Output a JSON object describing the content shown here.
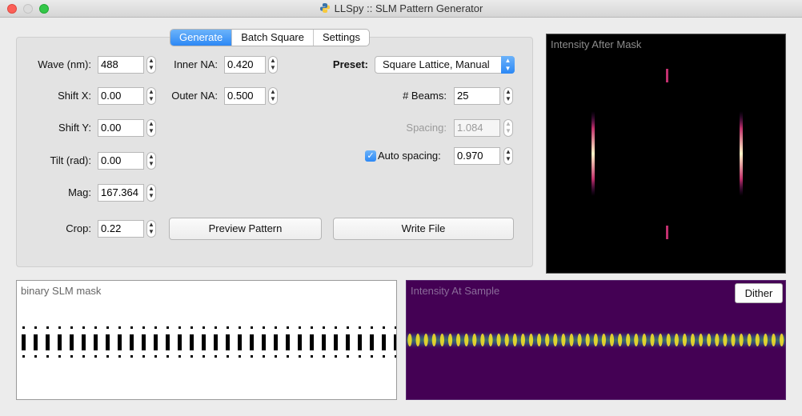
{
  "window": {
    "title": "LLSpy :: SLM Pattern Generator"
  },
  "tabs": [
    {
      "label": "Generate",
      "active": true
    },
    {
      "label": "Batch Square",
      "active": false
    },
    {
      "label": "Settings",
      "active": false
    }
  ],
  "left_fields": {
    "wave": {
      "label": "Wave (nm):",
      "value": "488"
    },
    "shift_x": {
      "label": "Shift X:",
      "value": "0.00"
    },
    "shift_y": {
      "label": "Shift Y:",
      "value": "0.00"
    },
    "tilt": {
      "label": "Tilt (rad):",
      "value": "0.00"
    },
    "mag": {
      "label": "Mag:",
      "value": "167.364"
    },
    "crop": {
      "label": "Crop:",
      "value": "0.22"
    }
  },
  "na_fields": {
    "inner": {
      "label": "Inner NA:",
      "value": "0.420"
    },
    "outer": {
      "label": "Outer NA:",
      "value": "0.500"
    }
  },
  "preset": {
    "label": "Preset:",
    "value": "Square Lattice, Manual"
  },
  "beams": {
    "label": "# Beams:",
    "value": "25"
  },
  "spacing": {
    "label": "Spacing:",
    "value": "1.084",
    "enabled": false
  },
  "auto_spacing": {
    "label": "Auto spacing:",
    "checked": true,
    "value": "0.970"
  },
  "buttons": {
    "preview": "Preview Pattern",
    "write": "Write File",
    "dither": "Dither"
  },
  "views": {
    "after_mask": "Intensity After Mask",
    "slm_mask": "binary SLM mask",
    "sample": "Intensity At Sample"
  },
  "colors": {
    "accent": "#2c88f5",
    "viridis_bg": "#440154",
    "window_bg": "#ececec"
  },
  "icons": {
    "app": "python-logo-icon",
    "stepper": "up-down-stepper-icon",
    "select": "dropdown-arrows-icon",
    "check": "checkmark-icon"
  }
}
